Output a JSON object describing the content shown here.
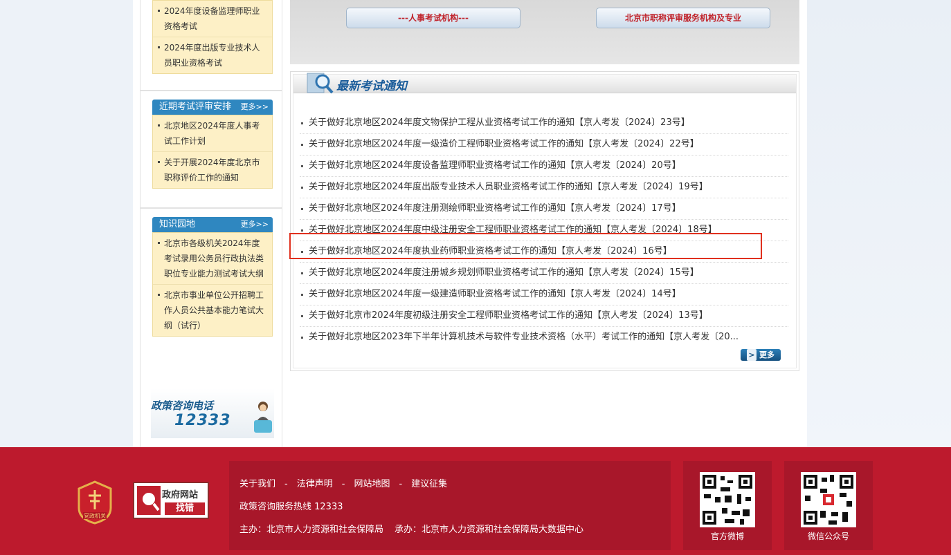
{
  "left_top_list": [
    "2024年度设备监理师职业资格考试",
    "2024年度出版专业技术人员职业资格考试"
  ],
  "recent_box": {
    "title": "近期考试评审安排",
    "more": "更多>>",
    "items": [
      "北京地区2024年度人事考试工作计划",
      "关于开展2024年度北京市职称评价工作的通知"
    ]
  },
  "knowledge_box": {
    "title": "知识园地",
    "more": "更多>>",
    "items": [
      "北京市各级机关2024年度考试录用公务员行政执法类职位专业能力测试考试大纲",
      "北京市事业单位公开招聘工作人员公共基本能力笔试大纲（试行）"
    ]
  },
  "phone_banner": {
    "title": "政策咨询电话",
    "number": "12333"
  },
  "top_buttons": {
    "left": "---人事考试机构---",
    "right": "北京市职称评审服务机构及专业"
  },
  "notices_panel": {
    "title": "最新考试通知",
    "more": "更多",
    "items": [
      "关于做好北京地区2024年度文物保护工程从业资格考试工作的通知【京人考发〔2024〕23号】",
      "关于做好北京地区2024年度一级造价工程师职业资格考试工作的通知【京人考发〔2024〕22号】",
      "关于做好北京地区2024年度设备监理师职业资格考试工作的通知【京人考发〔2024〕20号】",
      "关于做好北京地区2024年度出版专业技术人员职业资格考试工作的通知【京人考发〔2024〕19号】",
      "关于做好北京地区2024年度注册测绘师职业资格考试工作的通知【京人考发〔2024〕17号】",
      "关于做好北京地区2024年度中级注册安全工程师职业资格考试工作的通知【京人考发〔2024〕18号】",
      "关于做好北京地区2024年度执业药师职业资格考试工作的通知【京人考发〔2024〕16号】",
      "关于做好北京地区2024年度注册城乡规划师职业资格考试工作的通知【京人考发〔2024〕15号】",
      "关于做好北京地区2024年度一级建造师职业资格考试工作的通知【京人考发〔2024〕14号】",
      "关于做好北京市2024年度初级注册安全工程师职业资格考试工作的通知【京人考发〔2024〕13号】",
      "关于做好北京地区2023年下半年计算机技术与软件专业技术资格（水平）考试工作的通知【京人考发〔20..."
    ]
  },
  "footer": {
    "emblem_text": "党政机关",
    "findbug_top": "政府网站",
    "findbug_bottom": "找错",
    "links": [
      "关于我们",
      "法律声明",
      "网站地图",
      "建议征集"
    ],
    "link_sep": "-",
    "hotline": "政策咨询服务热线 12333",
    "host": "主办：北京市人力资源和社会保障局",
    "organizer": "承办：北京市人力资源和社会保障局大数据中心",
    "qr_weibo": "官方微博",
    "qr_wechat": "微信公众号"
  }
}
